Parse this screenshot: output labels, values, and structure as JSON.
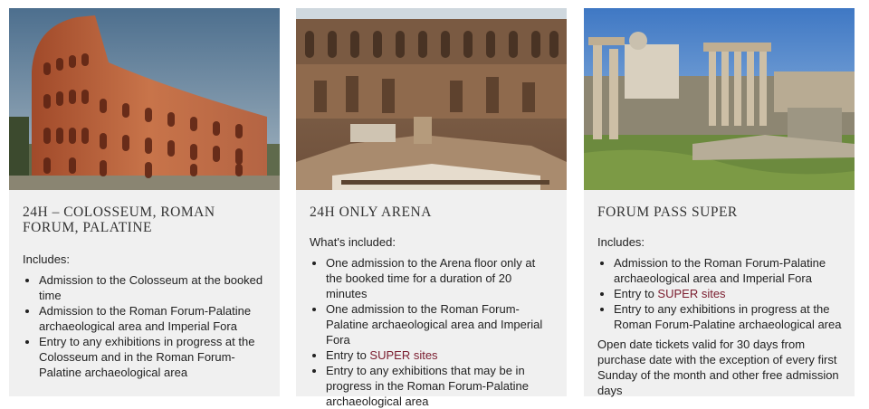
{
  "cards": [
    {
      "title": "24h – Colosseum, Roman Forum, Palatine",
      "intro": "Includes:",
      "items": [
        "Admission to the Colosseum at the booked time",
        "Admission to the Roman Forum-Palatine archaeological area and Imperial Fora",
        "Entry to any exhibitions in progress at the Colosseum and in the Roman Forum-Palatine archaeological area"
      ]
    },
    {
      "title": "24h only Arena",
      "intro": "What's included:",
      "items": [
        "One admission to the Arena floor only at the booked time for a duration of 20 minutes",
        "One admission to the Roman Forum-Palatine archaeological area and Imperial Fora"
      ],
      "link_prefix": "Entry to ",
      "link_text": "SUPER sites",
      "items_after": [
        "Entry to any exhibitions that may be in progress in the Roman Forum-Palatine archaeological area"
      ]
    },
    {
      "title": "Forum Pass SUPER",
      "intro": "Includes:",
      "items": [
        "Admission to the Roman Forum-Palatine archaeological area and Imperial Fora"
      ],
      "link_prefix": "Entry to ",
      "link_text": "SUPER sites",
      "items_after": [
        "Entry to any exhibitions in progress at the Roman Forum-Palatine archaeological area"
      ],
      "note": "Open date tickets valid for 30 days from purchase date with the exception of every first Sunday of the month and other free admission days"
    }
  ],
  "colors": {
    "card_bg": "#f0f0f0",
    "link": "#7a1b2d",
    "title": "#333333"
  }
}
